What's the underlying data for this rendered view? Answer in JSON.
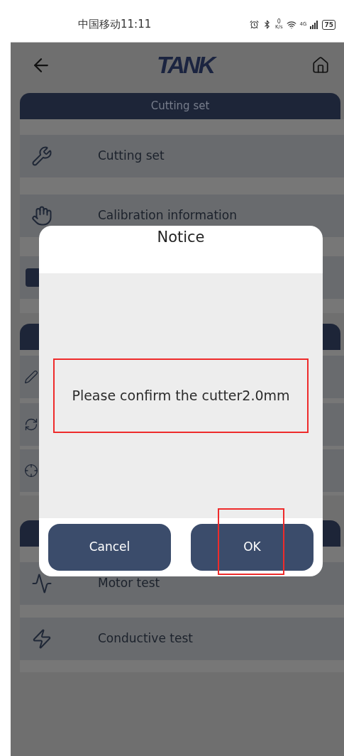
{
  "status_bar": {
    "carrier_time": "中国移动11:11",
    "net_speed": {
      "value": "0",
      "unit": "K/s"
    },
    "network": "4G",
    "battery": "75"
  },
  "header": {
    "logo": "TANK"
  },
  "sections": [
    {
      "title": "Cutting set",
      "items": [
        {
          "kind": "row",
          "label": "Cutting set"
        },
        {
          "kind": "row",
          "label": "Calibration information"
        },
        {
          "kind": "row"
        }
      ]
    },
    {
      "items": [
        {
          "kind": "row"
        },
        {
          "kind": "row"
        },
        {
          "kind": "row"
        }
      ]
    },
    {
      "items": [
        {
          "kind": "row",
          "label": "Motor test"
        },
        {
          "kind": "row",
          "label": "Conductive test"
        }
      ]
    }
  ],
  "dialog": {
    "title": "Notice",
    "message": "Please confirm the cutter2.0mm",
    "buttons": [
      {
        "label": "Cancel",
        "highlighted": false
      },
      {
        "label": "OK",
        "highlighted": true
      }
    ]
  }
}
